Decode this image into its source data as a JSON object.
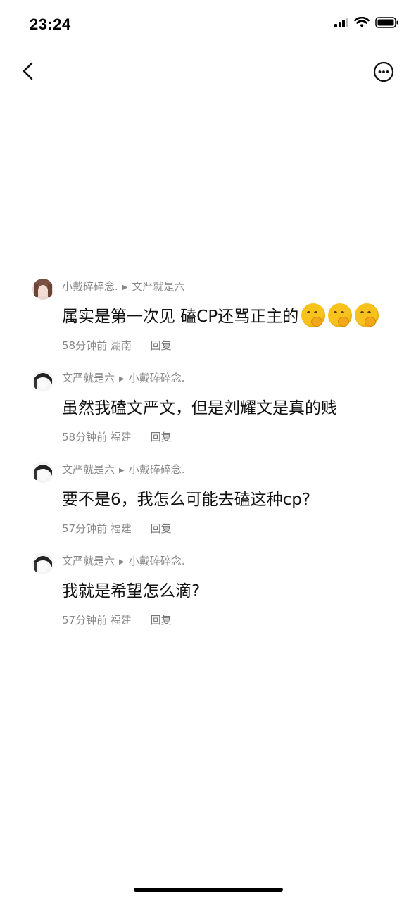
{
  "status": {
    "time": "23:24"
  },
  "colors": {
    "meta_text": "#888888",
    "body_text": "#111111",
    "emoji": "#f8c21d"
  },
  "nav": {
    "back_icon": "chevron-left-icon",
    "more_icon": "more-circle-icon"
  },
  "comments": [
    {
      "author": "小戴碎碎念.",
      "reply_to": "文严就是六",
      "text": "属实是第一次见 磕CP还骂正主的",
      "emoji_count": 3,
      "time": "58分钟前",
      "location": "湖南",
      "reply_label": "回复"
    },
    {
      "author": "文严就是六",
      "reply_to": "小戴碎碎念.",
      "text": "虽然我磕文严文，但是刘耀文是真的贱",
      "time": "58分钟前",
      "location": "福建",
      "reply_label": "回复"
    },
    {
      "author": "文严就是六",
      "reply_to": "小戴碎碎念.",
      "text": "要不是6，我怎么可能去磕这种cp?",
      "time": "57分钟前",
      "location": "福建",
      "reply_label": "回复"
    },
    {
      "author": "文严就是六",
      "reply_to": "小戴碎碎念.",
      "text": "我就是希望怎么滴?",
      "time": "57分钟前",
      "location": "福建",
      "reply_label": "回复"
    }
  ]
}
